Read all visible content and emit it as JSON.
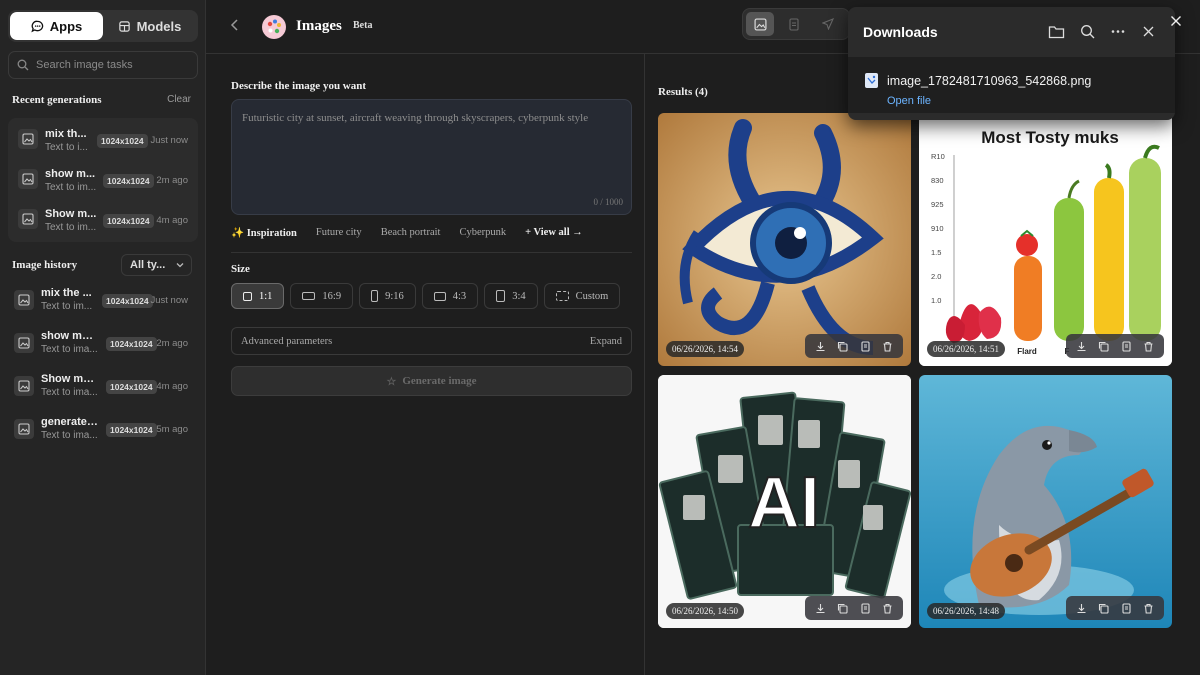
{
  "sidebar": {
    "tabs": [
      {
        "label": "Apps",
        "icon": "chat-icon"
      },
      {
        "label": "Models",
        "icon": "cube-icon"
      }
    ],
    "search_placeholder": "Search image tasks",
    "recent_title": "Recent generations",
    "clear_label": "Clear",
    "recent": [
      {
        "title": "mix th...",
        "subtitle": "Text to i...",
        "size": "1024x1024",
        "ago": "Just now"
      },
      {
        "title": "show m...",
        "subtitle": "Text to im...",
        "size": "1024x1024",
        "ago": "2m ago"
      },
      {
        "title": "Show m...",
        "subtitle": "Text to im...",
        "size": "1024x1024",
        "ago": "4m ago"
      }
    ],
    "history_title": "Image history",
    "type_filter": "All ty...",
    "history": [
      {
        "title": "mix the ...",
        "subtitle": "Text to im...",
        "size": "1024x1024",
        "ago": "Just now"
      },
      {
        "title": "show me ...",
        "subtitle": "Text to ima...",
        "size": "1024x1024",
        "ago": "2m ago"
      },
      {
        "title": "Show me ...",
        "subtitle": "Text to ima...",
        "size": "1024x1024",
        "ago": "4m ago"
      },
      {
        "title": "generate ...",
        "subtitle": "Text to ima...",
        "size": "1024x1024",
        "ago": "5m ago"
      }
    ]
  },
  "header": {
    "title": "Images",
    "badge": "Beta"
  },
  "form": {
    "prompt_label": "Describe the image you want",
    "prompt_placeholder": "Futuristic city at sunset, aircraft weaving through skyscrapers, cyberpunk style",
    "counter": "0 / 1000",
    "inspiration_label": "Inspiration",
    "inspirations": [
      "Future city",
      "Beach portrait",
      "Cyberpunk"
    ],
    "view_all": "+ View all →",
    "size_label": "Size",
    "sizes": [
      "1:1",
      "16:9",
      "9:16",
      "4:3",
      "3:4",
      "Custom"
    ],
    "advanced_label": "Advanced parameters",
    "expand_label": "Expand",
    "generate_label": "Generate image"
  },
  "results": {
    "title": "Results (4)",
    "items": [
      {
        "date": "06/26/2026, 14:54"
      },
      {
        "date": "06/26/2026, 14:51"
      },
      {
        "date": "06/26/2026, 14:50"
      },
      {
        "date": "06/26/2026, 14:48"
      }
    ],
    "chart_image": {
      "title": "Most Tosty muks",
      "ticks": [
        "R10",
        "830",
        "925",
        "910",
        "1.5",
        "2.0",
        "1.0"
      ],
      "labels": [
        "Flard",
        "F"
      ]
    },
    "ai_text": "AI"
  },
  "downloads": {
    "title": "Downloads",
    "filename": "image_1782481710963_542868.png",
    "open_label": "Open file"
  }
}
